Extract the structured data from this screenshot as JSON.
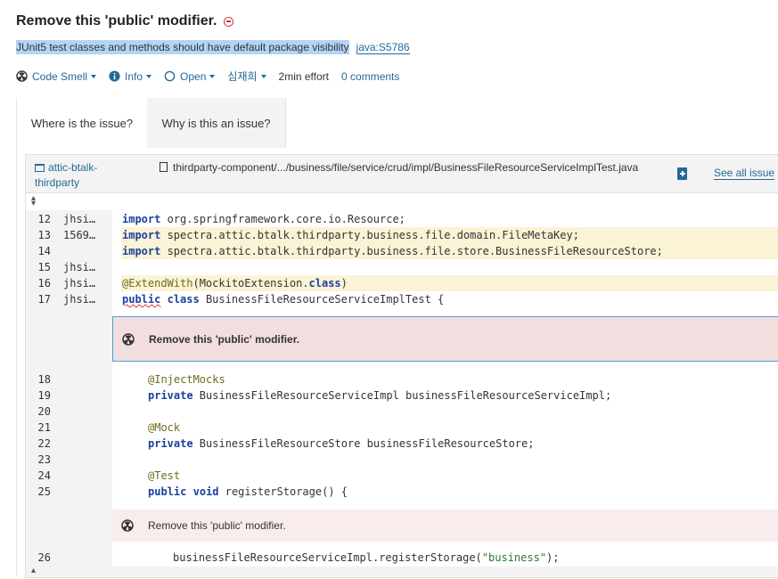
{
  "issue": {
    "title": "Remove this 'public' modifier.",
    "rule_text": "JUnit5 test classes and methods should have default package visibility",
    "rule_key": "java:S5786"
  },
  "meta": {
    "type": "Code Smell",
    "severity": "Info",
    "status": "Open",
    "assignee": "심재희",
    "effort": "2min effort",
    "comments": "0 comments"
  },
  "tabs": [
    {
      "label": "Where is the issue?",
      "active": true
    },
    {
      "label": "Why is this an issue?",
      "active": false
    }
  ],
  "viewer": {
    "project": "attic-btalk-thirdparty",
    "file_path": "thirdparty-component/.../business/file/service/crud/impl/BusinessFileResourceServiceImplTest.java",
    "see_all_label": "See all issue"
  },
  "code_lines": [
    {
      "ln": "12",
      "author": "jhsi…",
      "hl": false,
      "code": ""
    },
    {
      "ln": "13",
      "author": "1569…",
      "hl": true,
      "code": ""
    },
    {
      "ln": "14",
      "author": "",
      "hl": true,
      "code": ""
    },
    {
      "ln": "15",
      "author": "jhsi…",
      "hl": false,
      "code": ""
    },
    {
      "ln": "16",
      "author": "jhsi…",
      "hl": true,
      "code": ""
    },
    {
      "ln": "17",
      "author": "jhsi…",
      "hl": false,
      "code": ""
    },
    {
      "ln": "18",
      "author": "",
      "hl": false,
      "code": ""
    },
    {
      "ln": "19",
      "author": "",
      "hl": false,
      "code": ""
    },
    {
      "ln": "20",
      "author": "",
      "hl": false,
      "code": ""
    },
    {
      "ln": "21",
      "author": "",
      "hl": false,
      "code": ""
    },
    {
      "ln": "22",
      "author": "",
      "hl": false,
      "code": ""
    },
    {
      "ln": "23",
      "author": "",
      "hl": false,
      "code": ""
    },
    {
      "ln": "24",
      "author": "",
      "hl": false,
      "code": ""
    },
    {
      "ln": "25",
      "author": "",
      "hl": false,
      "code": ""
    },
    {
      "ln": "26",
      "author": "",
      "hl": false,
      "code": ""
    }
  ],
  "code_text": {
    "l12": {
      "kw": "import",
      "rest": " org.springframework.core.io.Resource;"
    },
    "l13": {
      "kw": "import",
      "rest": " spectra.attic.btalk.thirdparty.business.file.domain.FileMetaKey;"
    },
    "l14": {
      "kw": "import",
      "rest": " spectra.attic.btalk.thirdparty.business.file.store.BusinessFileResourceStore;"
    },
    "l16": {
      "ann": "@ExtendWith",
      "p1": "(MockitoExtension.",
      "kw": "class",
      "p2": ")"
    },
    "l17": {
      "kw1": "public",
      "kw2": "class",
      "rest": " BusinessFileResourceServiceImplTest {"
    },
    "l18": {
      "ann": "@InjectMocks"
    },
    "l19": {
      "kw": "private",
      "rest": " BusinessFileResourceServiceImpl businessFileResourceServiceImpl;"
    },
    "l21": {
      "ann": "@Mock"
    },
    "l22": {
      "kw": "private",
      "rest": " BusinessFileResourceStore businessFileResourceStore;"
    },
    "l24": {
      "ann": "@Test"
    },
    "l25": {
      "kw1": "public",
      "kw2": "void",
      "rest": " registerStorage() {"
    },
    "l26": {
      "p1": "businessFileResourceServiceImpl.registerStorage(",
      "str": "\"business\"",
      "p2": ");"
    }
  },
  "inline_issues": [
    {
      "message": "Remove this 'public' modifier.",
      "primary": true
    },
    {
      "message": "Remove this 'public' modifier.",
      "primary": false
    }
  ],
  "colors": {
    "link": "#236a97",
    "issue_bg": "#f2dede",
    "highlight": "#fbf3d5",
    "selection": "#b3d4f6"
  }
}
